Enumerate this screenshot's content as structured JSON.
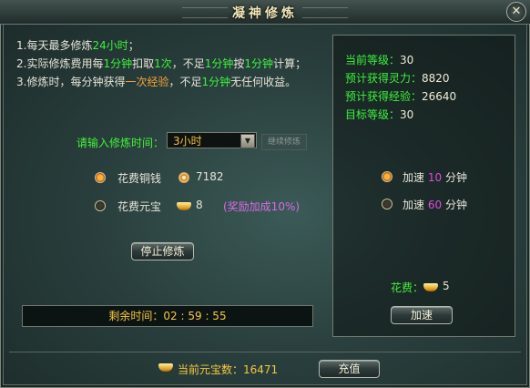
{
  "window": {
    "title": "凝神修炼"
  },
  "rules": {
    "line1": {
      "prefix": "1.每天最多修炼",
      "hl": "24小时",
      "suffix": "；"
    },
    "line2": {
      "p1": "2.实际修炼费用每",
      "h1": "1分钟",
      "p2": "扣取",
      "h2": "1次",
      "p3": "，不足",
      "h3": "1分钟",
      "p4": "按",
      "h4": "1分钟",
      "p5": "计算；"
    },
    "line3": {
      "p1": "3.修炼时，每分钟获得",
      "h1": "一次经验",
      "p2": "，不足",
      "h2": "1分钟",
      "p3": "无任何收益。"
    }
  },
  "time_input": {
    "label": "请输入修炼时间：",
    "selected": "3小时",
    "side_button": "继续修炼"
  },
  "cost_options": [
    {
      "label": "花费铜钱",
      "value": "7182",
      "icon": "copper-coin-icon",
      "selected": true
    },
    {
      "label": "花费元宝",
      "value": "8",
      "icon": "gold-ingot-icon",
      "selected": false,
      "bonus": "(奖励加成10%)"
    }
  ],
  "stop_button": "停止修炼",
  "remaining": {
    "label": "剩余时间：",
    "value": "02 : 59 : 55"
  },
  "stats": [
    {
      "key": "当前等级：",
      "value": "30"
    },
    {
      "key": "预计获得灵力：",
      "value": "8820"
    },
    {
      "key": "预计获得经验：",
      "value": "26640"
    },
    {
      "key": "目标等级：",
      "value": "30"
    }
  ],
  "speedup_options": [
    {
      "prefix": "加速",
      "minutes": "10",
      "unit": "分钟",
      "selected": true
    },
    {
      "prefix": "加速",
      "minutes": "60",
      "unit": "分钟",
      "selected": false
    }
  ],
  "speedup_cost": {
    "label": "花费：",
    "value": "5"
  },
  "speedup_button": "加速",
  "footer": {
    "label": "当前元宝数：",
    "value": "16471",
    "recharge_button": "充值"
  },
  "colors": {
    "highlight_green": "#3df23d",
    "highlight_orange": "#f5a23a",
    "gold_text": "#f4c842",
    "bonus_purple": "#d96be6"
  }
}
